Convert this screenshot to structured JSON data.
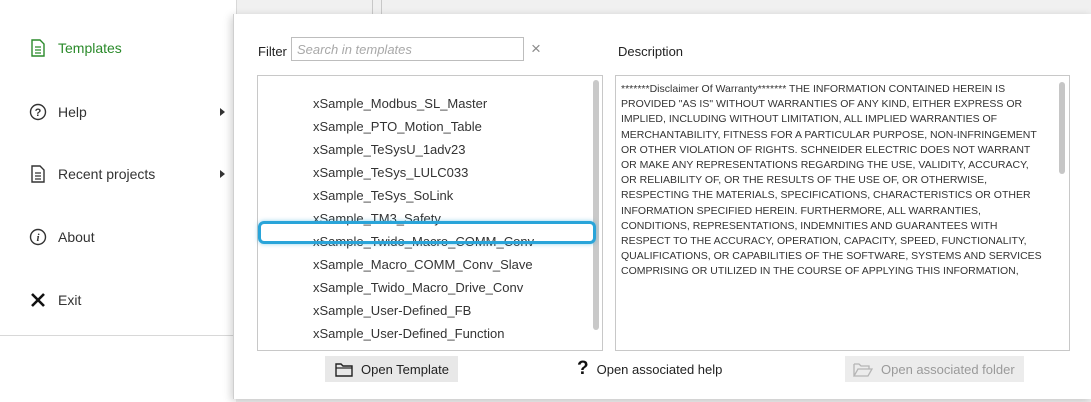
{
  "menu": {
    "items": [
      {
        "label": "Templates",
        "icon": "document-icon",
        "active": true
      },
      {
        "label": "Help",
        "icon": "help-circle-icon"
      },
      {
        "label": "Recent projects",
        "icon": "document-icon"
      },
      {
        "label": "About",
        "icon": "info-circle-icon"
      },
      {
        "label": "Exit",
        "icon": "close-x-icon"
      }
    ],
    "accent_color": "#2a8a2a"
  },
  "dialog": {
    "filter_label": "Filter",
    "filter_placeholder": "Search in templates",
    "clear_symbol": "×",
    "description_label": "Description",
    "templates": [
      "xSample_Modbus_SL_Master",
      "xSample_PTO_Motion_Table",
      "xSample_TeSysU_1adv23",
      "xSample_TeSys_LULC033",
      "xSample_TeSys_SoLink",
      "xSample_TM3_Safety",
      "xSample_Twido_Macro_COMM_Conv",
      "xSample_Macro_COMM_Conv_Slave",
      "xSample_Twido_Macro_Drive_Conv",
      "xSample_User-Defined_FB",
      "xSample_User-Defined_Function"
    ],
    "selected_template": "xSample_Twido_Macro_COMM_Conv",
    "highlight_color": "#29a4d9",
    "description_text": "*******Disclaimer Of Warranty******* THE INFORMATION CONTAINED HEREIN IS PROVIDED \"AS IS\" WITHOUT WARRANTIES OF ANY KIND, EITHER EXPRESS OR IMPLIED, INCLUDING WITHOUT LIMITATION, ALL IMPLIED WARRANTIES OF MERCHANTABILITY, FITNESS FOR A PARTICULAR PURPOSE, NON-INFRINGEMENT OR OTHER VIOLATION OF RIGHTS. SCHNEIDER ELECTRIC DOES NOT WARRANT OR MAKE ANY REPRESENTATIONS REGARDING THE USE, VALIDITY, ACCURACY, OR RELIABILITY OF, OR THE RESULTS OF THE USE OF, OR OTHERWISE, RESPECTING THE MATERIALS, SPECIFICATIONS, CHARACTERISTICS OR OTHER INFORMATION SPECIFIED HEREIN. FURTHERMORE, ALL WARRANTIES, CONDITIONS, REPRESENTATIONS, INDEMNITIES AND GUARANTEES WITH RESPECT TO THE ACCURACY, OPERATION, CAPACITY, SPEED, FUNCTIONALITY, QUALIFICATIONS, OR CAPABILITIES OF THE SOFTWARE, SYSTEMS AND SERVICES COMPRISING OR UTILIZED IN THE COURSE OF APPLYING THIS INFORMATION,",
    "buttons": {
      "open_template": "Open Template",
      "open_help": "Open associated help",
      "open_folder": "Open associated folder"
    }
  }
}
